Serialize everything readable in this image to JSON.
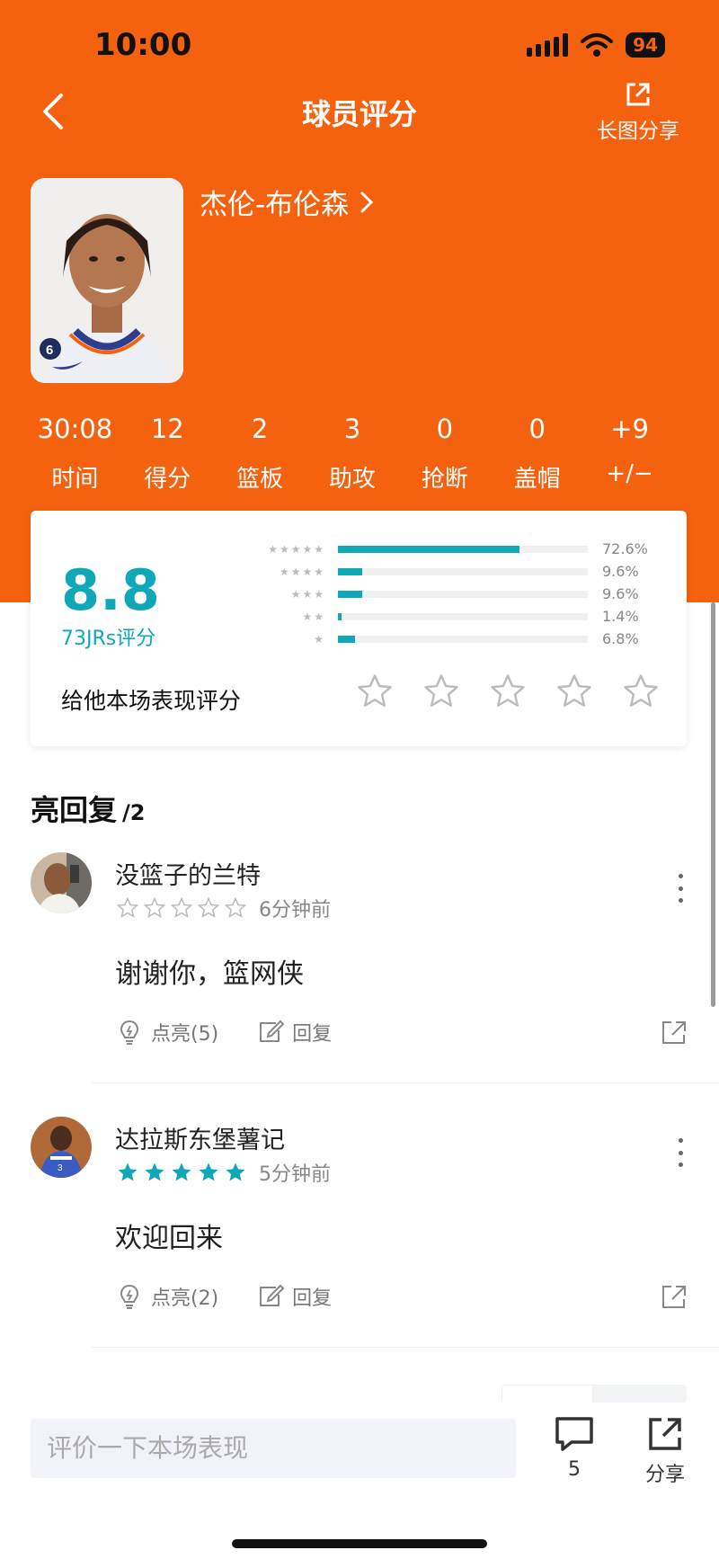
{
  "status_bar": {
    "time": "10:00",
    "battery": "94"
  },
  "header": {
    "title": "球员评分",
    "share_label": "长图分享"
  },
  "player": {
    "name": "杰伦-布伦森"
  },
  "stats": [
    {
      "value": "30:08",
      "label": "时间"
    },
    {
      "value": "12",
      "label": "得分"
    },
    {
      "value": "2",
      "label": "篮板"
    },
    {
      "value": "3",
      "label": "助攻"
    },
    {
      "value": "0",
      "label": "抢断"
    },
    {
      "value": "0",
      "label": "盖帽"
    },
    {
      "value": "+9",
      "label": "+/−"
    }
  ],
  "rating": {
    "score": "8.8",
    "count_label": "73JRs评分",
    "rate_prompt": "给他本场表现评分",
    "distribution": [
      {
        "stars": 5,
        "percent": 72.6,
        "label": "72.6%"
      },
      {
        "stars": 4,
        "percent": 9.6,
        "label": "9.6%"
      },
      {
        "stars": 3,
        "percent": 9.6,
        "label": "9.6%"
      },
      {
        "stars": 2,
        "percent": 1.4,
        "label": "1.4%"
      },
      {
        "stars": 1,
        "percent": 6.8,
        "label": "6.8%"
      }
    ]
  },
  "bright_replies": {
    "title": "亮回复",
    "count": "/2",
    "items": [
      {
        "user": "没篮子的兰特",
        "stars_filled": 0,
        "time": "6分钟前",
        "text": "谢谢你，篮网侠",
        "light_label": "点亮(5)",
        "reply_label": "回复"
      },
      {
        "user": "达拉斯东堡薯记",
        "stars_filled": 5,
        "time": "5分钟前",
        "text": "欢迎回来",
        "light_label": "点亮(2)",
        "reply_label": "回复"
      }
    ]
  },
  "bottom_bar": {
    "input_placeholder": "评价一下本场表现",
    "comment_count": "5",
    "share_label": "分享"
  },
  "colors": {
    "accent": "#f4610f",
    "teal": "#10a8b8"
  }
}
